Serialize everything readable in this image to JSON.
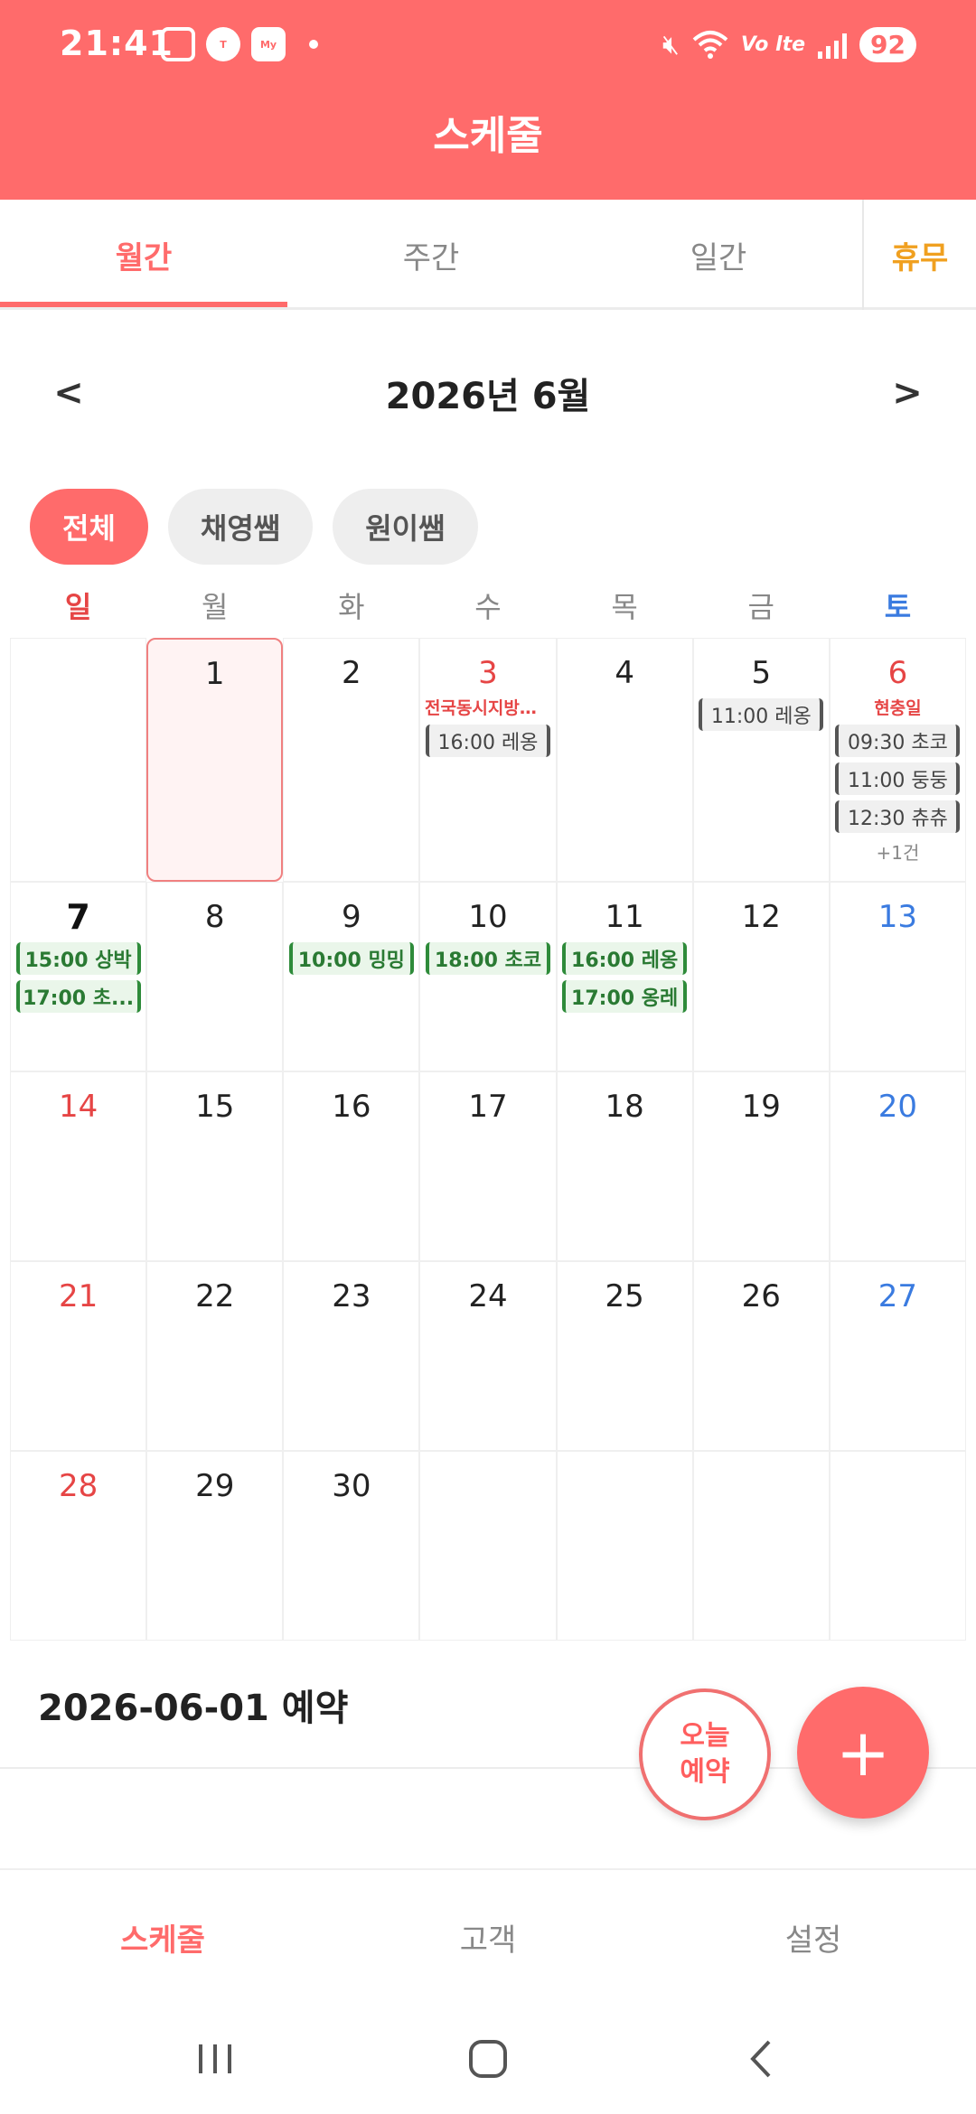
{
  "status_bar": {
    "time": "21:41",
    "icons_left": [
      "screen-capture-icon",
      "kakaotalk-icon",
      "samsung-fire-icon",
      "notification-dot-icon"
    ],
    "icons_right": [
      "mute-icon",
      "wifi-icon",
      "volte-icon",
      "signal-icon"
    ],
    "battery": "92",
    "lte_label": "Vo lte"
  },
  "header": {
    "title": "스케줄",
    "color": "#ff6b6b"
  },
  "tabs": [
    {
      "label": "월간",
      "active": true
    },
    {
      "label": "주간",
      "active": false
    },
    {
      "label": "일간",
      "active": false
    }
  ],
  "holiday_tab": {
    "label": "휴무"
  },
  "month_nav": {
    "prev": "<",
    "title": "2026년 6월",
    "next": ">"
  },
  "filters": [
    {
      "label": "전체",
      "active": true
    },
    {
      "label": "채영쌤",
      "active": false
    },
    {
      "label": "원이쌤",
      "active": false
    }
  ],
  "weekdays": [
    "일",
    "월",
    "화",
    "수",
    "목",
    "금",
    "토"
  ],
  "calendar": {
    "weeks": [
      [
        {
          "day": ""
        },
        {
          "day": "1",
          "selected": true
        },
        {
          "day": "2"
        },
        {
          "day": "3",
          "holiday": "전국동시지방선...",
          "events": [
            {
              "text": "16:00 레옹",
              "style": "gray"
            }
          ]
        },
        {
          "day": "4"
        },
        {
          "day": "5",
          "events": [
            {
              "text": "11:00 레옹",
              "style": "gray"
            }
          ]
        },
        {
          "day": "6",
          "holiday": "현충일",
          "events": [
            {
              "text": "09:30 초코",
              "style": "gray"
            },
            {
              "text": "11:00 둥둥",
              "style": "gray"
            },
            {
              "text": "12:30 츄츄",
              "style": "gray"
            }
          ],
          "more": "+1건"
        }
      ],
      [
        {
          "day": "7",
          "today": true,
          "events": [
            {
              "text": "15:00 상박",
              "style": "green"
            },
            {
              "text": "17:00 초...",
              "style": "green"
            }
          ]
        },
        {
          "day": "8"
        },
        {
          "day": "9",
          "events": [
            {
              "text": "10:00 밍밍",
              "style": "green"
            }
          ]
        },
        {
          "day": "10",
          "events": [
            {
              "text": "18:00 초코",
              "style": "green"
            }
          ]
        },
        {
          "day": "11",
          "events": [
            {
              "text": "16:00 레옹",
              "style": "green"
            },
            {
              "text": "17:00 옹레",
              "style": "green"
            }
          ]
        },
        {
          "day": "12"
        },
        {
          "day": "13"
        }
      ],
      [
        {
          "day": "14"
        },
        {
          "day": "15"
        },
        {
          "day": "16"
        },
        {
          "day": "17"
        },
        {
          "day": "18"
        },
        {
          "day": "19"
        },
        {
          "day": "20"
        }
      ],
      [
        {
          "day": "21"
        },
        {
          "day": "22"
        },
        {
          "day": "23"
        },
        {
          "day": "24"
        },
        {
          "day": "25"
        },
        {
          "day": "26"
        },
        {
          "day": "27"
        }
      ],
      [
        {
          "day": "28"
        },
        {
          "day": "29"
        },
        {
          "day": "30"
        },
        {
          "day": ""
        },
        {
          "day": ""
        },
        {
          "day": ""
        },
        {
          "day": ""
        }
      ]
    ]
  },
  "selected_date_label": "2026-06-01 예약",
  "fab_today": {
    "line1": "오늘",
    "line2": "예약"
  },
  "fab_add": {
    "label": "+"
  },
  "bottom_nav": [
    {
      "label": "스케줄",
      "active": true
    },
    {
      "label": "고객",
      "active": false
    },
    {
      "label": "설정",
      "active": false
    }
  ],
  "system_nav": {
    "buttons": [
      "recents-icon",
      "home-icon",
      "back-icon"
    ]
  }
}
